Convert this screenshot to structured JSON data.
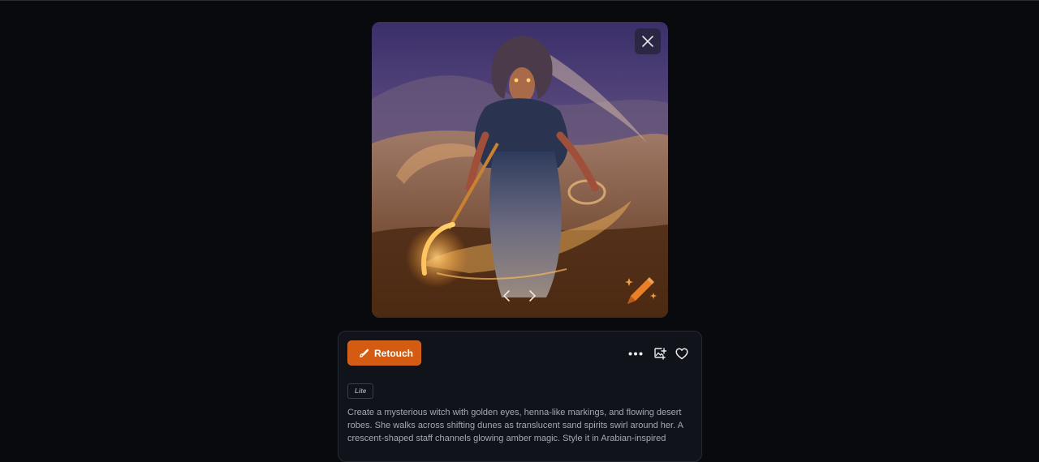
{
  "viewer": {
    "close_label": "Close",
    "prev_label": "Previous image",
    "next_label": "Next image"
  },
  "panel": {
    "retouch_label": "Retouch",
    "actions": {
      "more": "More options",
      "add_to_collection": "Add to collection",
      "like": "Like"
    },
    "model_badge": "Lite",
    "prompt": "Create a mysterious witch with golden eyes, henna-like markings, and flowing desert robes. She walks across shifting dunes as translucent sand spirits swirl around her. A crescent-shaped staff channels glowing amber magic. Style it in Arabian-inspired"
  },
  "colors": {
    "page_bg": "#090a0e",
    "panel_bg": "#10131a",
    "accent": "#d35c12",
    "badge_orange": "#e97f26"
  },
  "icons": {
    "close": "close-icon",
    "retouch": "brush-icon",
    "more": "more-dots-icon",
    "collection": "image-add-icon",
    "like": "heart-icon",
    "edit": "sparkle-pencil-icon"
  }
}
